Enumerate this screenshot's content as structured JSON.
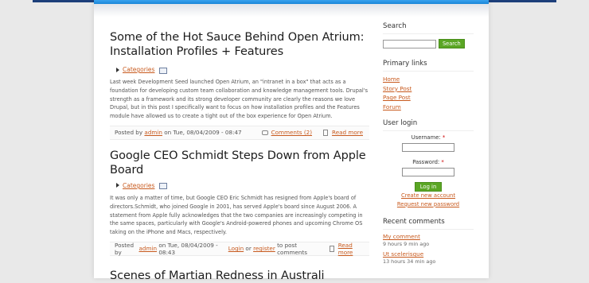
{
  "posts": [
    {
      "title": "Some of the Hot Sauce Behind Open Atrium: Installation Profiles + Features",
      "category": "Categories",
      "body": "Last week Development Seed launched Open Atrium, an \"intranet in a box\" that acts as a foundation for developing custom team collaboration and knowledge management tools. Drupal's strength as a framework and its strong developer community are clearly the reasons we love Drupal, but in this post I specifically want to focus on how installation profiles and the Features module have allowed us to create a tight out of the box experience for Open Atrium.",
      "posted_by": "Posted by",
      "author": "admin",
      "date": "on Tue, 08/04/2009 - 08:47",
      "comments": "Comments (2)",
      "read_more": "Read more"
    },
    {
      "title": "Google CEO Schmidt Steps Down from Apple Board",
      "category": "Categories",
      "body": "It was only a matter of time, but Google CEO Eric Schmidt has resigned from Apple's board of directors.Schmidt, who joined Google in 2001, has served Apple's board since August 2006. A statement from Apple fully acknowledges that the two companies are increasingly competing in the same spaces, particularly with Google's Android-powered phones and upcoming Chrome OS taking on the iPhone and Macs, respectively.",
      "posted_by": "Posted by",
      "author": "admin",
      "date": "on Tue, 08/04/2009 - 08:43",
      "login": "Login",
      "or": "or",
      "register": "register",
      "to_post": "to post comments",
      "read_more": "Read more"
    },
    {
      "title": "Scenes of Martian Redness in Australi"
    }
  ],
  "sidebar": {
    "search": {
      "heading": "Search",
      "button": "Search",
      "value": ""
    },
    "primary_links": {
      "heading": "Primary links",
      "items": [
        "Home",
        "Story Post",
        "Page Post",
        "Forum"
      ]
    },
    "login": {
      "heading": "User login",
      "username_label": "Username:",
      "password_label": "Password:",
      "required": "*",
      "button": "Log in",
      "create": "Create new account",
      "request": "Request new password"
    },
    "recent_comments": {
      "heading": "Recent comments",
      "items": [
        {
          "title": "My comment",
          "time": "9 hours 9 min ago"
        },
        {
          "title": "Ut scelerisque",
          "time": "13 hours 34 min ago"
        }
      ]
    }
  },
  "colors": {
    "link": "#c85a1e",
    "button": "#5aa624",
    "header_blue": "#1a86d8"
  }
}
